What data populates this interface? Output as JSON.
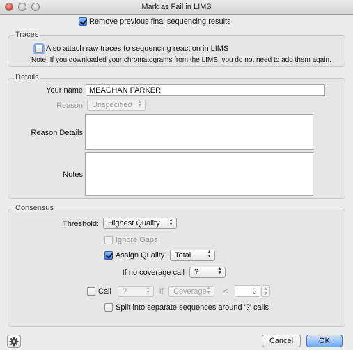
{
  "window": {
    "title": "Mark as Fail in LIMS"
  },
  "top": {
    "remove_previous_label": "Remove previous final sequencing results",
    "remove_previous_checked": true
  },
  "traces": {
    "title": "Traces",
    "attach_label": "Also attach raw traces to sequencing reaction in LIMS",
    "attach_checked": false,
    "note_prefix": "Note",
    "note_text": ": If you downloaded your chromatograms from the LIMS, you do not need to add them again."
  },
  "details": {
    "title": "Details",
    "your_name_label": "Your name",
    "your_name_value": "MEAGHAN PARKER",
    "reason_label": "Reason",
    "reason_value": "Unspecified",
    "reason_details_label": "Reason Details",
    "notes_label": "Notes"
  },
  "consensus": {
    "title": "Consensus",
    "threshold_label": "Threshold:",
    "threshold_value": "Highest Quality",
    "ignore_gaps_label": "Ignore Gaps",
    "assign_quality_label": "Assign Quality",
    "assign_quality_value": "Total",
    "no_coverage_label": "If no coverage call",
    "no_coverage_value": "?",
    "call_label": "Call",
    "call_value": "?",
    "if_label": "if",
    "coverage_value": "Coverage",
    "lt_label": "<",
    "coverage_number": "2",
    "split_label": "Split into separate sequences around '?' calls"
  },
  "footer": {
    "cancel_label": "Cancel",
    "ok_label": "OK"
  },
  "icons": {
    "gear": "gear-icon",
    "popup_arrows": "popup-arrows-icon"
  }
}
